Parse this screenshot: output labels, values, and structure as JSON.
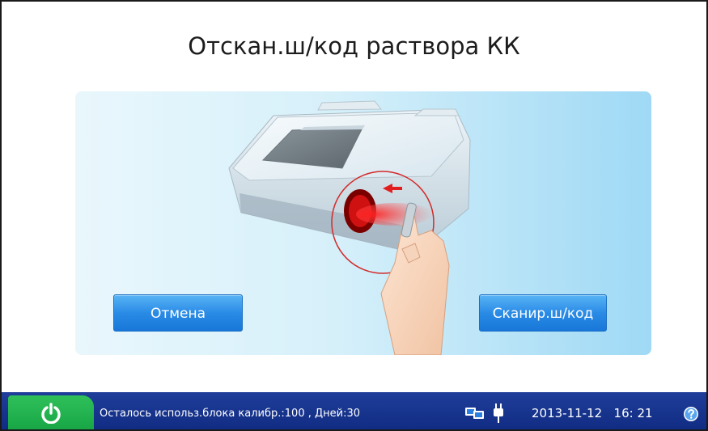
{
  "screen": {
    "title": "Отскан.ш/код раствора КК"
  },
  "buttons": {
    "cancel_label": "Отмена",
    "scan_label": "Сканир.ш/код"
  },
  "statusbar": {
    "power_icon": "power-icon",
    "remaining_text": "Осталось использ.блока калибр.:100 , Дней:30",
    "network_icon": "network-icon",
    "plug_icon": "plug-icon",
    "date": "2013-11-12",
    "time": "16: 21",
    "help_icon": "help-icon"
  },
  "colors": {
    "accent_blue": "#2a8be6",
    "statusbar": "#102b82",
    "power_green": "#17a545",
    "scan_beam": "#e21d1d"
  }
}
